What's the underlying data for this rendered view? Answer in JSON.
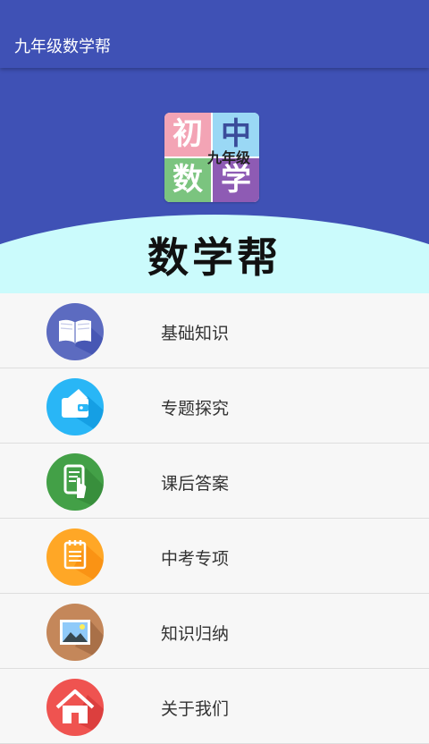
{
  "appbar": {
    "title": "九年级数学帮"
  },
  "hero": {
    "logo": {
      "q1": "初",
      "q2": "中",
      "q3": "数",
      "q4": "学",
      "sub": "九年级"
    },
    "title": "数学帮"
  },
  "menu": {
    "items": [
      {
        "label": "基础知识",
        "icon": "book-icon",
        "color": "#5c6bc0"
      },
      {
        "label": "专题探究",
        "icon": "wallet-icon",
        "color": "#29b6f6"
      },
      {
        "label": "课后答案",
        "icon": "tablet-touch-icon",
        "color": "#43a047"
      },
      {
        "label": "中考专项",
        "icon": "notepad-icon",
        "color": "#ffa726"
      },
      {
        "label": "知识归纳",
        "icon": "picture-icon",
        "color": "#c4875a"
      },
      {
        "label": "关于我们",
        "icon": "home-icon",
        "color": "#ef5350"
      }
    ]
  }
}
